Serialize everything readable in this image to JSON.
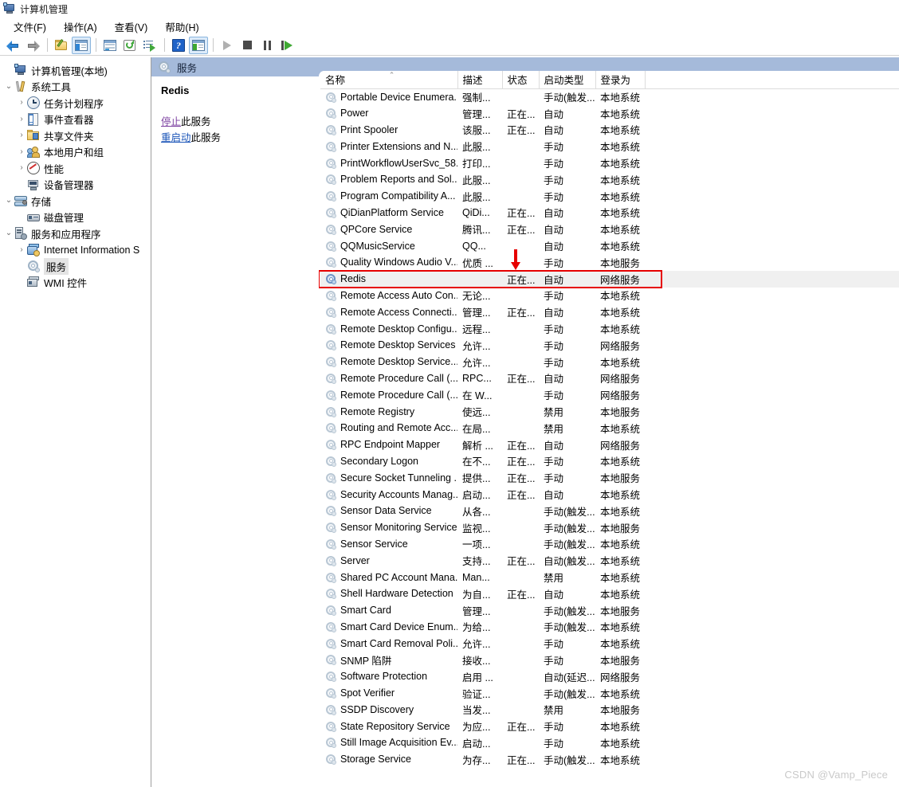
{
  "window": {
    "title": "计算机管理",
    "icon": "computer-management-icon"
  },
  "menu": {
    "items": [
      {
        "label": "文件(F)"
      },
      {
        "label": "操作(A)"
      },
      {
        "label": "查看(V)"
      },
      {
        "label": "帮助(H)"
      }
    ]
  },
  "toolbar": {
    "buttons": [
      {
        "name": "back-button",
        "icon": "back-arrow-icon",
        "checked": false
      },
      {
        "name": "forward-button",
        "icon": "forward-arrow-icon",
        "checked": false
      },
      {
        "name": "up-folder-button",
        "icon": "folder-pencil-icon",
        "checked": false
      },
      {
        "name": "show-hide-tree-button",
        "icon": "pane-left-icon",
        "checked": true
      },
      {
        "name": "properties-button",
        "icon": "properties-window-icon",
        "checked": false
      },
      {
        "name": "refresh-button",
        "icon": "refresh-icon",
        "checked": false
      },
      {
        "name": "export-list-button",
        "icon": "export-list-icon",
        "checked": false
      },
      {
        "name": "help-button",
        "icon": "help-question-icon",
        "checked": false
      },
      {
        "name": "show-action-pane-button",
        "icon": "pane-right-icon",
        "checked": true
      },
      {
        "name": "start-service-button",
        "icon": "play-icon",
        "checked": false
      },
      {
        "name": "stop-service-button",
        "icon": "stop-icon",
        "checked": false
      },
      {
        "name": "pause-service-button",
        "icon": "pause-icon",
        "checked": false
      },
      {
        "name": "restart-service-button",
        "icon": "restart-icon",
        "checked": false
      }
    ]
  },
  "tree": {
    "nodes": [
      {
        "label": "计算机管理(本地)",
        "indent": 0,
        "chevron": "",
        "icon": "computer-icon",
        "selected": false
      },
      {
        "label": "系统工具",
        "indent": 0,
        "chevron": "v",
        "icon": "system-tools-icon",
        "selected": false
      },
      {
        "label": "任务计划程序",
        "indent": 1,
        "chevron": ">",
        "icon": "clock-icon",
        "selected": false
      },
      {
        "label": "事件查看器",
        "indent": 1,
        "chevron": ">",
        "icon": "event-viewer-icon",
        "selected": false
      },
      {
        "label": "共享文件夹",
        "indent": 1,
        "chevron": ">",
        "icon": "shared-folder-icon",
        "selected": false
      },
      {
        "label": "本地用户和组",
        "indent": 1,
        "chevron": ">",
        "icon": "users-groups-icon",
        "selected": false
      },
      {
        "label": "性能",
        "indent": 1,
        "chevron": ">",
        "icon": "performance-icon",
        "selected": false
      },
      {
        "label": "设备管理器",
        "indent": 1,
        "chevron": "",
        "icon": "device-manager-icon",
        "selected": false
      },
      {
        "label": "存储",
        "indent": 0,
        "chevron": "v",
        "icon": "storage-icon",
        "selected": false
      },
      {
        "label": "磁盘管理",
        "indent": 1,
        "chevron": "",
        "icon": "disk-management-icon",
        "selected": false
      },
      {
        "label": "服务和应用程序",
        "indent": 0,
        "chevron": "v",
        "icon": "services-apps-icon",
        "selected": false
      },
      {
        "label": "Internet Information S",
        "indent": 1,
        "chevron": ">",
        "icon": "iis-icon",
        "selected": false
      },
      {
        "label": "服务",
        "indent": 1,
        "chevron": "",
        "icon": "services-icon",
        "selected": true
      },
      {
        "label": "WMI 控件",
        "indent": 1,
        "chevron": "",
        "icon": "wmi-control-icon",
        "selected": false
      }
    ]
  },
  "band": {
    "title": "服务",
    "icon": "services-icon"
  },
  "details": {
    "service_name": "Redis",
    "links": [
      {
        "name": "stop-service-link",
        "underlined": "停止",
        "plain": "此服务",
        "style": "stop"
      },
      {
        "name": "restart-service-link",
        "underlined": "重启动",
        "plain": "此服务",
        "style": "restart"
      }
    ]
  },
  "list": {
    "columns": [
      {
        "label": "名称",
        "sorted": "asc"
      },
      {
        "label": "描述",
        "sorted": ""
      },
      {
        "label": "状态",
        "sorted": ""
      },
      {
        "label": "启动类型",
        "sorted": ""
      },
      {
        "label": "登录为",
        "sorted": ""
      }
    ],
    "rows": [
      {
        "name": "Portable Device Enumera...",
        "desc": "强制...",
        "status": "",
        "startup": "手动(触发...",
        "logon": "本地系统",
        "highlight": false
      },
      {
        "name": "Power",
        "desc": "管理...",
        "status": "正在...",
        "startup": "自动",
        "logon": "本地系统",
        "highlight": false
      },
      {
        "name": "Print Spooler",
        "desc": "该服...",
        "status": "正在...",
        "startup": "自动",
        "logon": "本地系统",
        "highlight": false
      },
      {
        "name": "Printer Extensions and N...",
        "desc": "此服...",
        "status": "",
        "startup": "手动",
        "logon": "本地系统",
        "highlight": false
      },
      {
        "name": "PrintWorkflowUserSvc_58...",
        "desc": "打印...",
        "status": "",
        "startup": "手动",
        "logon": "本地系统",
        "highlight": false
      },
      {
        "name": "Problem Reports and Sol...",
        "desc": "此服...",
        "status": "",
        "startup": "手动",
        "logon": "本地系统",
        "highlight": false
      },
      {
        "name": "Program Compatibility A...",
        "desc": "此服...",
        "status": "",
        "startup": "手动",
        "logon": "本地系统",
        "highlight": false
      },
      {
        "name": "QiDianPlatform Service",
        "desc": "QiDi...",
        "status": "正在...",
        "startup": "自动",
        "logon": "本地系统",
        "highlight": false
      },
      {
        "name": "QPCore Service",
        "desc": "腾讯...",
        "status": "正在...",
        "startup": "自动",
        "logon": "本地系统",
        "highlight": false
      },
      {
        "name": "QQMusicService",
        "desc": "QQ...",
        "status": "",
        "startup": "自动",
        "logon": "本地系统",
        "highlight": false
      },
      {
        "name": "Quality Windows Audio V...",
        "desc": "优质 ...",
        "status": "",
        "startup": "手动",
        "logon": "本地服务",
        "highlight": false
      },
      {
        "name": "Redis",
        "desc": "",
        "status": "正在...",
        "startup": "自动",
        "logon": "网络服务",
        "highlight": true
      },
      {
        "name": "Remote Access Auto Con...",
        "desc": "无论...",
        "status": "",
        "startup": "手动",
        "logon": "本地系统",
        "highlight": false
      },
      {
        "name": "Remote Access Connecti...",
        "desc": "管理...",
        "status": "正在...",
        "startup": "自动",
        "logon": "本地系统",
        "highlight": false
      },
      {
        "name": "Remote Desktop Configu...",
        "desc": "远程...",
        "status": "",
        "startup": "手动",
        "logon": "本地系统",
        "highlight": false
      },
      {
        "name": "Remote Desktop Services",
        "desc": "允许...",
        "status": "",
        "startup": "手动",
        "logon": "网络服务",
        "highlight": false
      },
      {
        "name": "Remote Desktop Service...",
        "desc": "允许...",
        "status": "",
        "startup": "手动",
        "logon": "本地系统",
        "highlight": false
      },
      {
        "name": "Remote Procedure Call (...",
        "desc": "RPC...",
        "status": "正在...",
        "startup": "自动",
        "logon": "网络服务",
        "highlight": false
      },
      {
        "name": "Remote Procedure Call (...",
        "desc": "在 W...",
        "status": "",
        "startup": "手动",
        "logon": "网络服务",
        "highlight": false
      },
      {
        "name": "Remote Registry",
        "desc": "使远...",
        "status": "",
        "startup": "禁用",
        "logon": "本地服务",
        "highlight": false
      },
      {
        "name": "Routing and Remote Acc...",
        "desc": "在局...",
        "status": "",
        "startup": "禁用",
        "logon": "本地系统",
        "highlight": false
      },
      {
        "name": "RPC Endpoint Mapper",
        "desc": "解析 ...",
        "status": "正在...",
        "startup": "自动",
        "logon": "网络服务",
        "highlight": false
      },
      {
        "name": "Secondary Logon",
        "desc": "在不...",
        "status": "正在...",
        "startup": "手动",
        "logon": "本地系统",
        "highlight": false
      },
      {
        "name": "Secure Socket Tunneling ...",
        "desc": "提供...",
        "status": "正在...",
        "startup": "手动",
        "logon": "本地服务",
        "highlight": false
      },
      {
        "name": "Security Accounts Manag...",
        "desc": "启动...",
        "status": "正在...",
        "startup": "自动",
        "logon": "本地系统",
        "highlight": false
      },
      {
        "name": "Sensor Data Service",
        "desc": "从各...",
        "status": "",
        "startup": "手动(触发...",
        "logon": "本地系统",
        "highlight": false
      },
      {
        "name": "Sensor Monitoring Service",
        "desc": "监视...",
        "status": "",
        "startup": "手动(触发...",
        "logon": "本地服务",
        "highlight": false
      },
      {
        "name": "Sensor Service",
        "desc": "一项...",
        "status": "",
        "startup": "手动(触发...",
        "logon": "本地系统",
        "highlight": false
      },
      {
        "name": "Server",
        "desc": "支持...",
        "status": "正在...",
        "startup": "自动(触发...",
        "logon": "本地系统",
        "highlight": false
      },
      {
        "name": "Shared PC Account Mana...",
        "desc": "Man...",
        "status": "",
        "startup": "禁用",
        "logon": "本地系统",
        "highlight": false
      },
      {
        "name": "Shell Hardware Detection",
        "desc": "为自...",
        "status": "正在...",
        "startup": "自动",
        "logon": "本地系统",
        "highlight": false
      },
      {
        "name": "Smart Card",
        "desc": "管理...",
        "status": "",
        "startup": "手动(触发...",
        "logon": "本地服务",
        "highlight": false
      },
      {
        "name": "Smart Card Device Enum...",
        "desc": "为给...",
        "status": "",
        "startup": "手动(触发...",
        "logon": "本地系统",
        "highlight": false
      },
      {
        "name": "Smart Card Removal Poli...",
        "desc": "允许...",
        "status": "",
        "startup": "手动",
        "logon": "本地系统",
        "highlight": false
      },
      {
        "name": "SNMP 陷阱",
        "desc": "接收...",
        "status": "",
        "startup": "手动",
        "logon": "本地服务",
        "highlight": false
      },
      {
        "name": "Software Protection",
        "desc": "启用 ...",
        "status": "",
        "startup": "自动(延迟...",
        "logon": "网络服务",
        "highlight": false
      },
      {
        "name": "Spot Verifier",
        "desc": "验证...",
        "status": "",
        "startup": "手动(触发...",
        "logon": "本地系统",
        "highlight": false
      },
      {
        "name": "SSDP Discovery",
        "desc": "当发...",
        "status": "",
        "startup": "禁用",
        "logon": "本地服务",
        "highlight": false
      },
      {
        "name": "State Repository Service",
        "desc": "为应...",
        "status": "正在...",
        "startup": "手动",
        "logon": "本地系统",
        "highlight": false
      },
      {
        "name": "Still Image Acquisition Ev...",
        "desc": "启动...",
        "status": "",
        "startup": "手动",
        "logon": "本地系统",
        "highlight": false
      },
      {
        "name": "Storage Service",
        "desc": "为存...",
        "status": "正在...",
        "startup": "手动(触发...",
        "logon": "本地系统",
        "highlight": false
      }
    ]
  },
  "annotation": {
    "highlight_color": "#e60000",
    "arrow": "down-arrow-annotation"
  },
  "watermark": {
    "text": "CSDN @Vamp_Piece"
  }
}
